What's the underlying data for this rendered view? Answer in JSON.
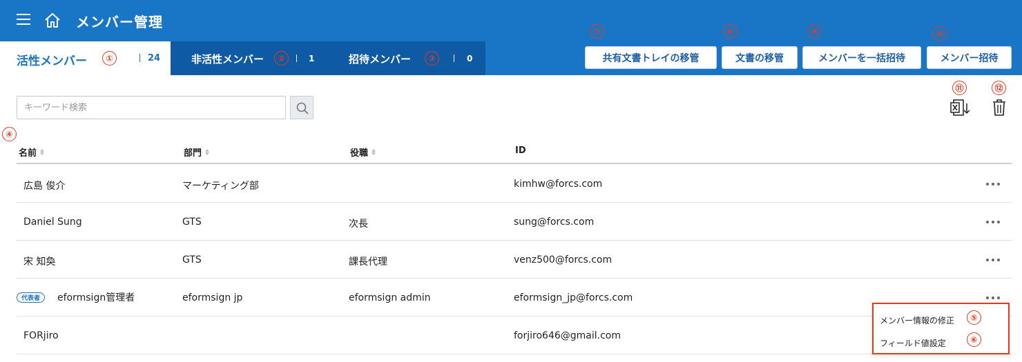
{
  "header": {
    "title": "メンバー管理",
    "menu_icon": "hamburger-icon",
    "home_icon": "home-icon"
  },
  "tabs": [
    {
      "label": "活性メンバー",
      "count": "24",
      "active": true
    },
    {
      "label": "非活性メンバー",
      "count": "1",
      "active": false
    },
    {
      "label": "招待メンバー",
      "count": "0",
      "active": false
    }
  ],
  "toolbar": {
    "shared_tray_transfer": "共有文書トレイの移管",
    "doc_transfer": "文書の移管",
    "bulk_invite": "メンバーを一括招待",
    "invite": "メンバー招待"
  },
  "search": {
    "placeholder": "キーワード検索",
    "value": "",
    "button_icon": "search-icon"
  },
  "actions": {
    "excel_icon": "excel-download-icon",
    "delete_icon": "trash-icon"
  },
  "table": {
    "columns": {
      "name": "名前",
      "dept": "部門",
      "role": "役職",
      "id": "ID"
    },
    "rows": [
      {
        "name": "広島 俊介",
        "dept": "マーケティング部",
        "role": "",
        "id": "kimhw@forcs.com",
        "badge": ""
      },
      {
        "name": "Daniel Sung",
        "dept": "GTS",
        "role": "次長",
        "id": "sung@forcs.com",
        "badge": ""
      },
      {
        "name": "宋 知奐",
        "dept": "GTS",
        "role": "課長代理",
        "id": "venz500@forcs.com",
        "badge": ""
      },
      {
        "name": "eformsign管理者",
        "dept": "eformsign jp",
        "role": "eformsign admin",
        "id": "eformsign_jp@forcs.com",
        "badge": "代表者"
      },
      {
        "name": "FORjiro",
        "dept": "",
        "role": "",
        "id": "forjiro646@gmail.com",
        "badge": ""
      }
    ]
  },
  "context_menu": {
    "edit_member": "メンバー情報の修正",
    "field_value": "フィールド値設定"
  },
  "annotations": [
    "①",
    "②",
    "③",
    "④",
    "⑤",
    "⑥",
    "⑦",
    "⑧",
    "⑨",
    "⑩",
    "⑪",
    "⑫"
  ],
  "colors": {
    "primary": "#1976c7",
    "tab_dark": "#0f5aa5",
    "annotation": "#e8391a"
  }
}
